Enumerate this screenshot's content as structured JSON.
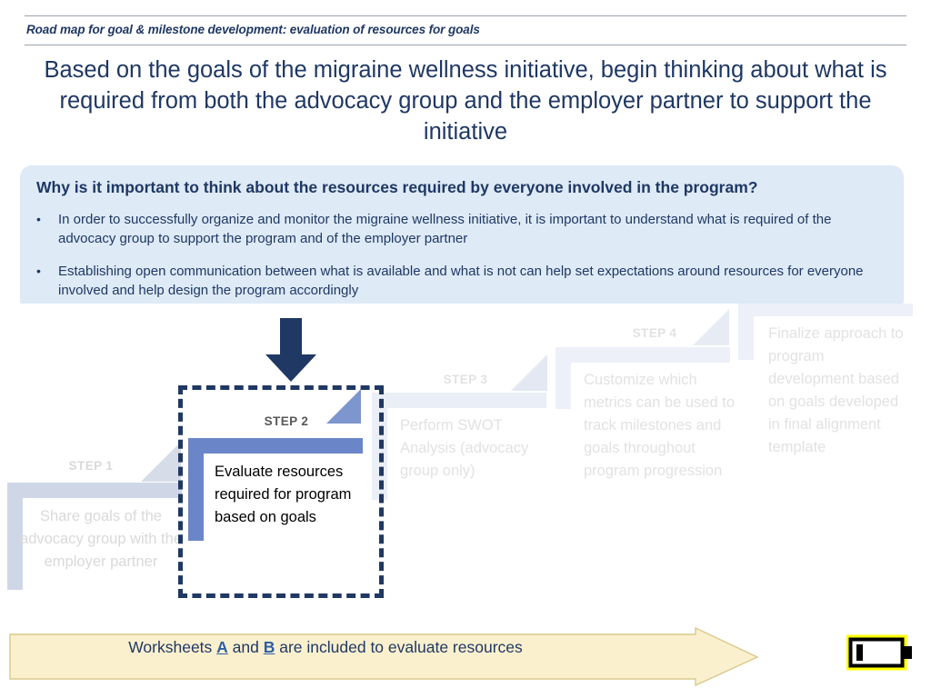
{
  "header": {
    "subtitle": "Road map for goal & milestone development: evaluation of resources for goals",
    "title": "Based on the goals of the migraine wellness initiative, begin thinking about what is required from both the advocacy group and the employer partner to support the initiative"
  },
  "callout": {
    "heading": "Why is it important to think about the resources required by everyone involved in the program?",
    "bullet_marker": "•",
    "bullets": [
      "In order to successfully organize and monitor the migraine wellness initiative, it is important to understand what is required of the advocacy group to support the program and of the employer partner",
      "Establishing open communication between what is available and what is not can help set expectations around resources for everyone involved and help design the program accordingly"
    ],
    "background_color": "#DEEAF6"
  },
  "roadmap": {
    "active_step_index": 1,
    "steps": [
      {
        "label": "STEP 1",
        "text": "Share goals of the advocacy group with the employer partner",
        "state": "inactive",
        "bracket_color": "#CFD7E6",
        "text_color": "#D9D9D9"
      },
      {
        "label": "STEP 2",
        "text": "Evaluate resources required for program based on goals",
        "state": "active",
        "bracket_color": "#6B86C8",
        "text_color": "#000000"
      },
      {
        "label": "STEP 3",
        "text": "Perform SWOT Analysis (advocacy group only)",
        "state": "inactive",
        "bracket_color": "#EAEEF7",
        "text_color": "#E2E2E2"
      },
      {
        "label": "STEP 4",
        "text": "Customize which metrics can be used to track milestones and goals throughout program progression",
        "state": "inactive",
        "bracket_color": "#EDF0F8",
        "text_color": "#E2E2E2"
      },
      {
        "label": "",
        "text": "Finalize approach to program development based on goals developed in final alignment template",
        "state": "inactive",
        "bracket_color": "#EDF0F8",
        "text_color": "#E2E2E2"
      }
    ],
    "highlight": {
      "dashed_border_color": "#1F3864",
      "down_arrow_color": "#1F3864",
      "down_arrow_icon": "arrow-down-icon"
    }
  },
  "banner": {
    "text_prefix": "Worksheets ",
    "link_a": "A",
    "text_mid": " and ",
    "link_b": "B",
    "text_suffix": " are included to evaluate resources",
    "fill_color": "#FBF0CE",
    "border_color": "#D9C98B",
    "text_color": "#1F3864",
    "link_color": "#2E5FA3"
  },
  "battery": {
    "icon": "battery-low-icon",
    "outline_color": "#FFFF00",
    "body_color": "#000000",
    "level_bars": 1
  },
  "theme": {
    "title_color": "#1F3864",
    "rule_color": "#9AA3AD",
    "page_background": "#FFFFFF"
  }
}
